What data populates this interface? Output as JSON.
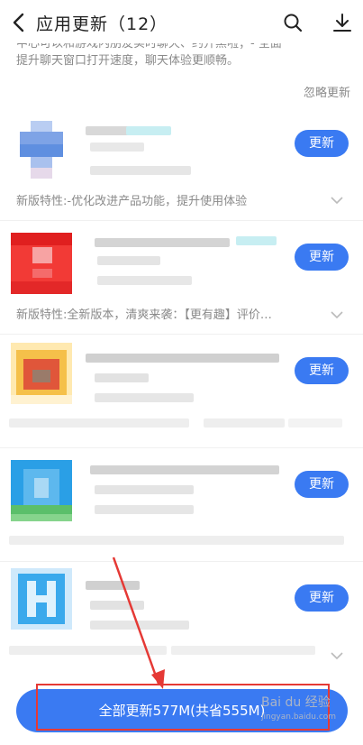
{
  "header": {
    "title": "应用更新（12）",
    "back_icon": "chevron-left-icon",
    "search_icon": "search-icon",
    "download_icon": "download-icon"
  },
  "top_description": {
    "line1": "中心可以和游戏内朋友实时聊天、约开黑啦；- 全面",
    "line2": "提升聊天窗口打开速度，聊天体验更顺畅。",
    "ignore_label": "忽略更新"
  },
  "apps": [
    {
      "update_label": "更新",
      "feature": "新版特性:-优化改进产品功能，提升使用体验"
    },
    {
      "update_label": "更新",
      "feature": "新版特性:全新版本，清爽来袭：【更有趣】评价…"
    },
    {
      "update_label": "更新",
      "feature": ""
    },
    {
      "update_label": "更新",
      "feature": ""
    },
    {
      "update_label": "更新",
      "feature": ""
    }
  ],
  "footer": {
    "update_all_label": "全部更新577M(共省555M)"
  },
  "watermark": {
    "brand": "Bai du 经验",
    "url": "jingyan.baidu.com"
  },
  "colors": {
    "accent": "#3a7af2",
    "annotation_red": "#e53935"
  }
}
